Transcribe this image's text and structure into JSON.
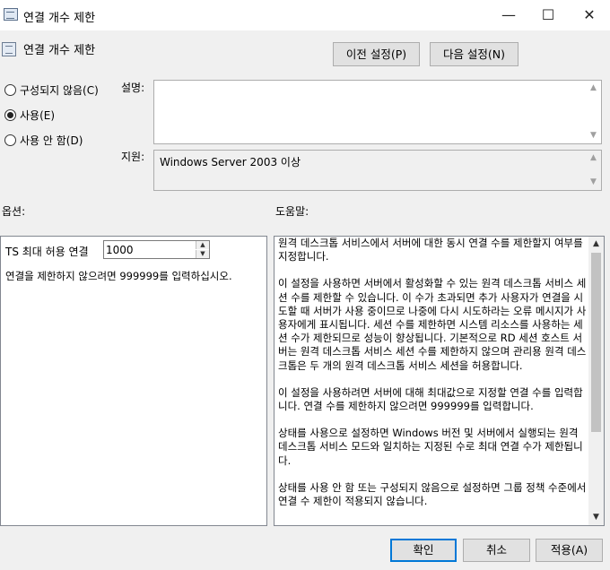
{
  "window": {
    "title": "연결 개수 제한",
    "minimize_glyph": "—",
    "maximize_glyph": "☐",
    "close_glyph": "✕"
  },
  "header": {
    "title": "연결 개수 제한",
    "prev_button": "이전 설정(P)",
    "next_button": "다음 설정(N)"
  },
  "state": {
    "options": [
      {
        "label": "구성되지 않음(C)",
        "selected": false
      },
      {
        "label": "사용(E)",
        "selected": true
      },
      {
        "label": "사용 안 함(D)",
        "selected": false
      }
    ]
  },
  "comment": {
    "label": "설명:",
    "value": ""
  },
  "supported": {
    "label": "지원:",
    "value": "Windows Server 2003 이상"
  },
  "options_section": {
    "label": "옵션:",
    "max_connections_label": "TS 최대 허용 연결",
    "max_connections_value": "1000",
    "hint": "연결을 제한하지 않으려면 999999를 입력하십시오."
  },
  "help_section": {
    "label": "도움말:",
    "paragraphs": [
      "원격 데스크톱 서비스에서 서버에 대한 동시 연결 수를 제한할지 여부를 지정합니다.",
      "이 설정을 사용하면 서버에서 활성화할 수 있는 원격 데스크톱 서비스 세션 수를 제한할 수 있습니다. 이 수가 초과되면 추가 사용자가 연결을 시도할 때 서버가 사용 중이므로 나중에 다시 시도하라는 오류 메시지가 사용자에게 표시됩니다. 세션 수를 제한하면 시스템 리소스를 사용하는 세션 수가 제한되므로 성능이 향상됩니다. 기본적으로 RD 세션 호스트 서버는 원격 데스크톱 서비스 세션 수를 제한하지 않으며 관리용 원격 데스크톱은 두 개의 원격 데스크톱 서비스 세션을 허용합니다.",
      "이 설정을 사용하려면 서버에 대해 최대값으로 지정할 연결 수를 입력합니다. 연결 수를 제한하지 않으려면 999999를 입력합니다.",
      "상태를 사용으로 설정하면 Windows 버전 및 서버에서 실행되는 원격 데스크톱 서비스 모드와 일치하는 지정된 수로 최대 연결 수가 제한됩니다.",
      "상태를 사용 안 함 또는 구성되지 않음으로 설정하면 그룹 정책 수준에서 연결 수 제한이 적용되지 않습니다."
    ]
  },
  "footer": {
    "ok": "확인",
    "cancel": "취소",
    "apply": "적용(A)"
  }
}
